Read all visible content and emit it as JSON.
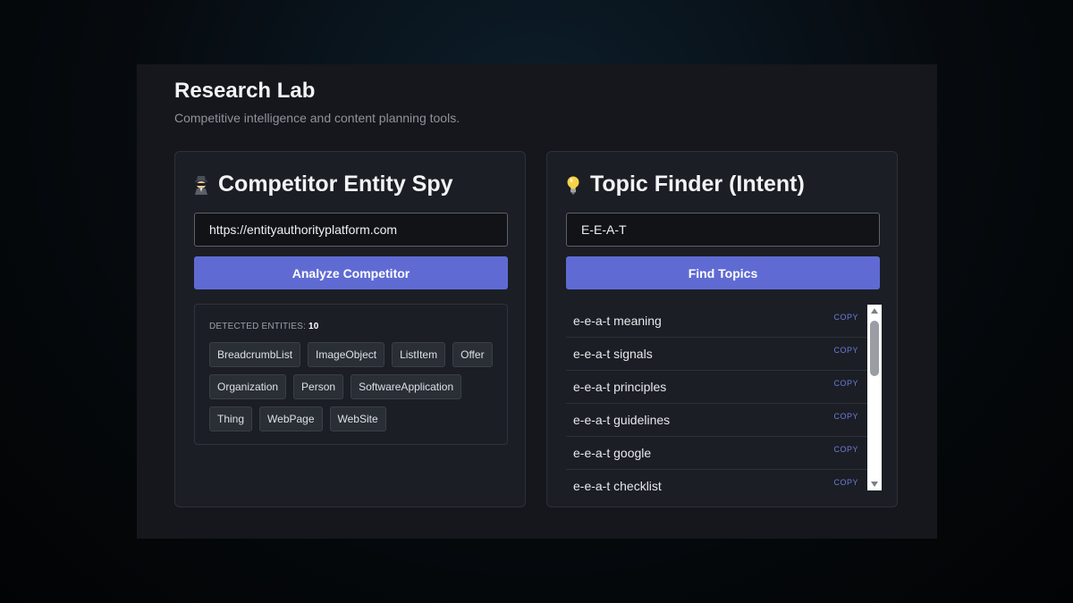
{
  "header": {
    "title": "Research Lab",
    "subtitle": "Competitive intelligence and content planning tools."
  },
  "competitor_spy": {
    "title": "Competitor Entity Spy",
    "icon": "spy-icon",
    "url_value": "https://entityauthorityplatform.com",
    "analyze_label": "Analyze Competitor",
    "detected_label": "DETECTED ENTITIES:",
    "detected_count": "10",
    "entities": [
      "BreadcrumbList",
      "ImageObject",
      "ListItem",
      "Offer",
      "Organization",
      "Person",
      "SoftwareApplication",
      "Thing",
      "WebPage",
      "WebSite"
    ]
  },
  "topic_finder": {
    "title": "Topic Finder (Intent)",
    "icon": "lightbulb-icon",
    "query_value": "E-E-A-T",
    "find_label": "Find Topics",
    "copy_label": "COPY",
    "topics": [
      "e-e-a-t meaning",
      "e-e-a-t signals",
      "e-e-a-t principles",
      "e-e-a-t guidelines",
      "e-e-a-t google",
      "e-e-a-t checklist"
    ]
  },
  "colors": {
    "accent": "#5f6bd3",
    "copy": "#6d7bdb",
    "card_bg": "#1b1e24",
    "panel_bg": "#15171c"
  }
}
